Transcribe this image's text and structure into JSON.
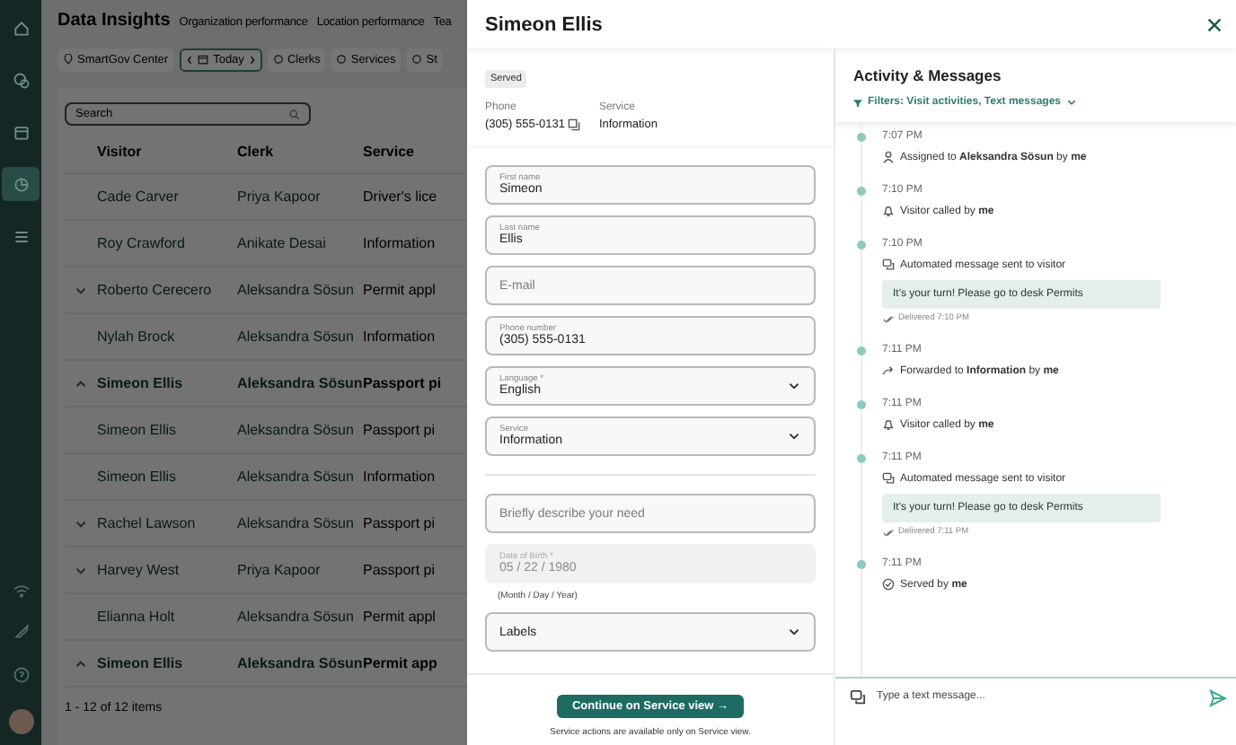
{
  "sidebar": {
    "nav": [
      {
        "selected": false
      },
      {
        "selected": false
      },
      {
        "selected": false
      },
      {
        "selected": true
      },
      {
        "selected": false
      }
    ]
  },
  "page": {
    "title": "Data Insights",
    "tabs": [
      "Organization performance",
      "Location performance",
      "Tea"
    ]
  },
  "filters": {
    "location": "SmartGov Center",
    "date": "Today",
    "chips": [
      "Clerks",
      "Services",
      "St"
    ]
  },
  "search": {
    "placeholder": "Search"
  },
  "table": {
    "columns": [
      "Visitor",
      "Clerk",
      "Service"
    ],
    "rows": [
      {
        "visitor": "Cade Carver",
        "clerk": "Priya Kapoor",
        "service": "Driver's lice",
        "expandable": false,
        "expanded": false
      },
      {
        "visitor": "Roy Crawford",
        "clerk": "Anikate Desai",
        "service": "Information",
        "expandable": false,
        "expanded": false
      },
      {
        "visitor": "Roberto Cerecero",
        "clerk": "Aleksandra Sösun",
        "service": "Permit appl",
        "expandable": true,
        "expanded": false
      },
      {
        "visitor": "Nylah Brock",
        "clerk": "Aleksandra Sösun",
        "service": "Information",
        "expandable": false,
        "expanded": false
      },
      {
        "visitor": "Simeon Ellis",
        "clerk": "Aleksandra Sösun",
        "service": "Passport pi",
        "expandable": true,
        "expanded": true
      },
      {
        "visitor": "Simeon Ellis",
        "clerk": "Aleksandra Sösun",
        "service": "Passport pi",
        "expandable": false,
        "expanded": false
      },
      {
        "visitor": "Simeon Ellis",
        "clerk": "Aleksandra Sösun",
        "service": "Information",
        "expandable": false,
        "expanded": false
      },
      {
        "visitor": "Rachel Lawson",
        "clerk": "Aleksandra Sösun",
        "service": "Passport pi",
        "expandable": true,
        "expanded": false
      },
      {
        "visitor": "Harvey West",
        "clerk": "Priya Kapoor",
        "service": "Passport pi",
        "expandable": true,
        "expanded": false
      },
      {
        "visitor": "Elianna Holt",
        "clerk": "Aleksandra Sösun",
        "service": "Permit appl",
        "expandable": false,
        "expanded": false
      },
      {
        "visitor": "Simeon Ellis",
        "clerk": "Aleksandra Sösun",
        "service": "Permit app",
        "expandable": true,
        "expanded": true
      }
    ],
    "footer": "1 - 12 of 12 items"
  },
  "drawer": {
    "title": "Simeon Ellis",
    "status": "Served",
    "info": [
      {
        "label": "Phone",
        "value": "(305) 555-0131",
        "copyable": true
      },
      {
        "label": "Service",
        "value": "Information",
        "copyable": false
      }
    ],
    "fields": [
      {
        "kind": "text",
        "label": "First name",
        "value": "Simeon"
      },
      {
        "kind": "text",
        "label": "Last name",
        "value": "Ellis"
      },
      {
        "kind": "text",
        "placeholder": "E-mail"
      },
      {
        "kind": "text",
        "label": "Phone number",
        "value": "(305) 555-0131"
      },
      {
        "kind": "select",
        "label": "Language *",
        "value": "English"
      },
      {
        "kind": "select",
        "label": "Service",
        "value": "Information"
      }
    ],
    "details": [
      {
        "kind": "text",
        "placeholder": "Briefly describe your need"
      },
      {
        "kind": "date",
        "label": "Date of Birth *",
        "value": "05 / 22 / 1980",
        "hint": "(Month / Day / Year)",
        "disabled": true
      },
      {
        "kind": "select",
        "value": "Labels"
      }
    ],
    "action": {
      "label": "Continue on Service view →",
      "note": "Service actions are available only on Service view."
    }
  },
  "activity": {
    "title": "Activity & Messages",
    "filter": "Filters: Visit activities, Text messages",
    "items": [
      {
        "time": "7:07 PM",
        "kind": "assigned",
        "text": "Assigned to **Aleksandra Sösun** by **me**"
      },
      {
        "time": "7:10 PM",
        "kind": "called",
        "text": "Visitor called by **me**"
      },
      {
        "time": "7:10 PM",
        "kind": "message",
        "text": "Automated message sent to visitor",
        "message": "It's your turn! Please go to desk Permits",
        "delivered": "Delivered 7:10 PM"
      },
      {
        "time": "7:11 PM",
        "kind": "forwarded",
        "text": "Forwarded to **Information** by **me**"
      },
      {
        "time": "7:11 PM",
        "kind": "called",
        "text": "Visitor called by **me**"
      },
      {
        "time": "7:11 PM",
        "kind": "message",
        "text": "Automated message sent to visitor",
        "message": "It's your turn! Please go to desk Permits",
        "delivered": "Delivered 7:11 PM"
      },
      {
        "time": "7:11 PM",
        "kind": "served",
        "text": "Served by **me**"
      }
    ],
    "composer": {
      "placeholder": "Type a text message..."
    }
  }
}
